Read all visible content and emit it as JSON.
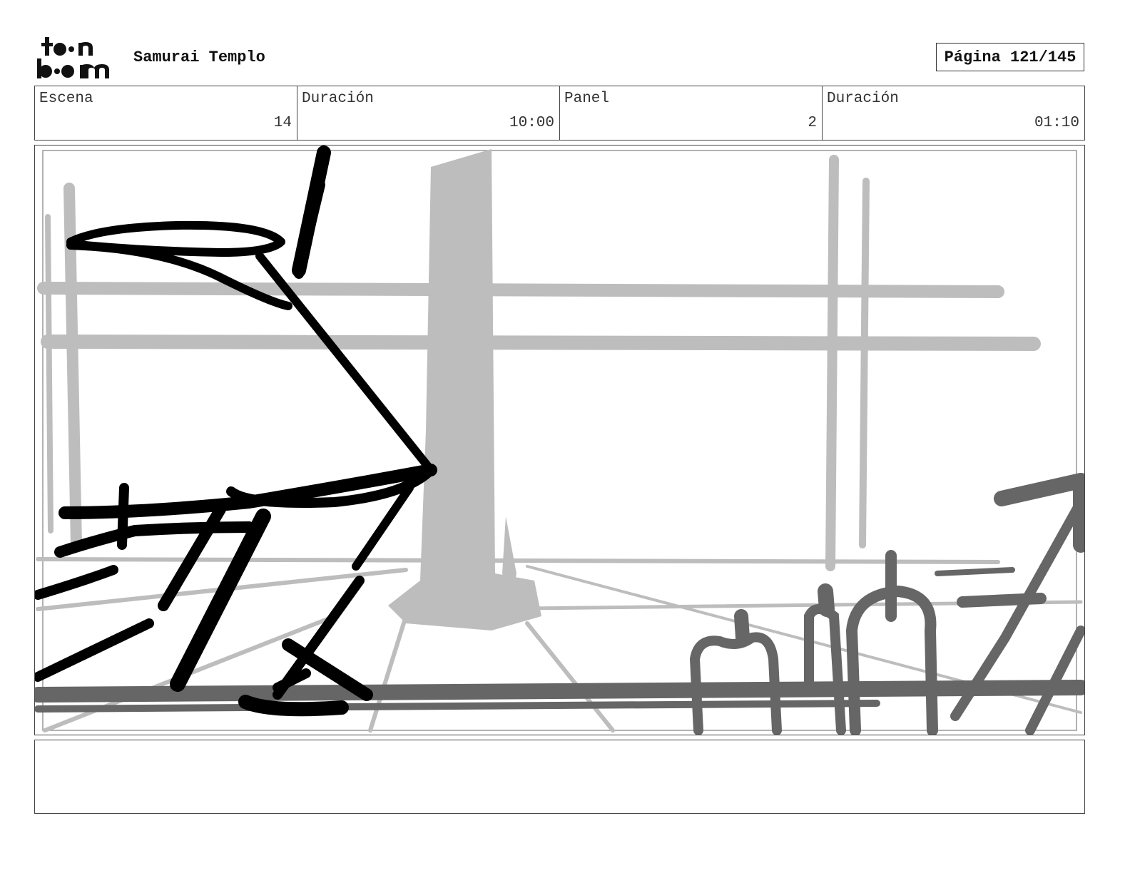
{
  "header": {
    "logo_text_top": "toon",
    "logo_text_bottom": "boom",
    "project_title": "Samurai Templo",
    "page_label": "Página 121/145"
  },
  "info": {
    "scene_label": "Escena",
    "scene_value": "14",
    "scene_duration_label": "Duración",
    "scene_duration_value": "10:00",
    "panel_label": "Panel",
    "panel_value": "2",
    "panel_duration_label": "Duración",
    "panel_duration_value": "01:10"
  },
  "notes": {
    "text": ""
  }
}
